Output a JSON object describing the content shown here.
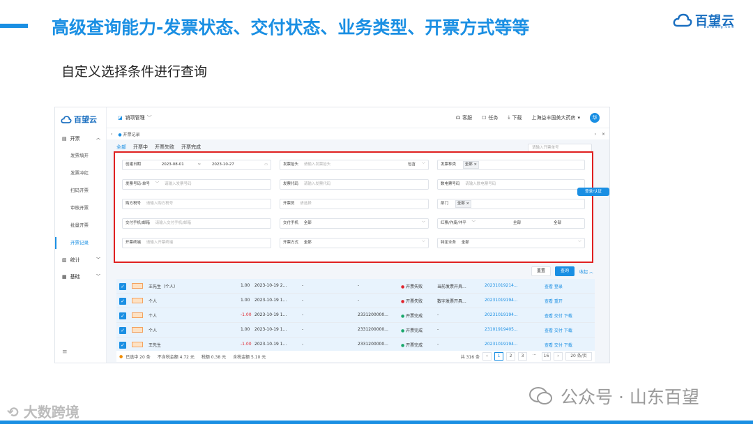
{
  "slide": {
    "title": "高级查询能力-发票状态、交付状态、业务类型、开票方式等等",
    "subtitle": "自定义选择条件进行查询",
    "brand": "百望云",
    "brand_sub": "baiwang.com"
  },
  "app": {
    "logo": "百望云",
    "topbar": {
      "module": "销项管理",
      "items": [
        "客服",
        "任务",
        "下载"
      ],
      "company": "上海益丰国美大药房",
      "avatar": "华"
    },
    "sidebar": {
      "group_invoice": "开票",
      "items": [
        "发票填开",
        "发票冲红",
        "扫码开票",
        "审核开票",
        "批量开票",
        "开票记录"
      ],
      "group_stats": "统计",
      "group_basic": "基础"
    },
    "breadcrumb": "开票记录",
    "tabs": [
      "全部",
      "开票中",
      "开票失败",
      "开票完成"
    ],
    "tab_search_placeholder": "请输入开票单号",
    "filters": {
      "date_label": "创建日期",
      "date_from": "2023-08-01",
      "date_sep": "~",
      "date_to": "2023-10-27",
      "title_label": "发票抬头",
      "title_ph": "请输入发票抬头",
      "title_mode": "包含",
      "kind_label": "发票种类",
      "kind_value": "全部",
      "number_label": "发票号码-单号",
      "number_ph": "请输入发票号码",
      "code_label": "发票代码",
      "code_ph": "请输入发票代码",
      "einv_label": "数电票号码",
      "einv_ph": "请输入数电票号码",
      "tax_label": "购方税号",
      "tax_ph": "请输入购方税号",
      "drawer_label": "开票员",
      "drawer_ph": "请选择",
      "dept_label": "部门",
      "dept_value": "全部",
      "delivery_label": "交付手机/邮箱",
      "delivery_ph": "请输入交付手机/邮箱",
      "delivery_mode_label": "交付手机",
      "delivery_mode_value": "全部",
      "red_label": "红票/作废/冲平",
      "red_value1": "全部",
      "red_value2": "全部",
      "red_value3": "全部",
      "terminal_label": "开票终端",
      "terminal_ph": "请输入开票终端",
      "method_label": "开票方式",
      "method_value": "全部",
      "biz_label": "特定业务",
      "biz_value": "全部"
    },
    "buttons": {
      "reset": "重置",
      "search": "查询",
      "collapse": "收起"
    },
    "float_button": "登录/认证",
    "rows": [
      {
        "name": "王先生（个人）",
        "amount": "1.00",
        "date": "2023-10-19 2...",
        "c1": "-",
        "c2": "-",
        "status": "开票失败",
        "status_type": "fail",
        "desc": "当前发票开具...",
        "no": "20231019214...",
        "actions": "查看  登录"
      },
      {
        "name": "个人",
        "amount": "1.00",
        "date": "2023-10-19 1...",
        "c1": "-",
        "c2": "-",
        "status": "开票失败",
        "status_type": "fail",
        "desc": "数字发票开具...",
        "no": "20231019194...",
        "actions": "查看  重开"
      },
      {
        "name": "个人",
        "amount": "-1.00",
        "date": "2023-10-19 1...",
        "c1": "-",
        "c2": "2331200000...",
        "status": "开票完成",
        "status_type": "ok",
        "desc": "-",
        "no": "20231019194...",
        "actions": "查看  交付  下载"
      },
      {
        "name": "个人",
        "amount": "1.00",
        "date": "2023-10-19 1...",
        "c1": "-",
        "c2": "2331200000...",
        "status": "开票完成",
        "status_type": "ok",
        "desc": "-",
        "no": "23101919405...",
        "actions": "查看  交付  下载"
      },
      {
        "name": "王先生",
        "amount": "-1.00",
        "date": "2023-10-19 1...",
        "c1": "-",
        "c2": "2331200000...",
        "status": "开票完成",
        "status_type": "ok",
        "desc": "-",
        "no": "20231019194...",
        "actions": "查看  交付  下载"
      }
    ],
    "footer": {
      "selected": "已选中 20 条",
      "untaxed": "不含税金额 4.72 元",
      "tax": "税额 0.38 元",
      "taxed": "含税金额 5.10 元",
      "total": "共 316 条",
      "pages": [
        "1",
        "2",
        "3",
        "···",
        "16"
      ],
      "page_size": "20 条/页"
    }
  },
  "watermark": {
    "right": "公众号 · 山东百望",
    "left": "大数跨境"
  },
  "colors": {
    "accent": "#1a8fe3",
    "highlight": "#e02020"
  }
}
